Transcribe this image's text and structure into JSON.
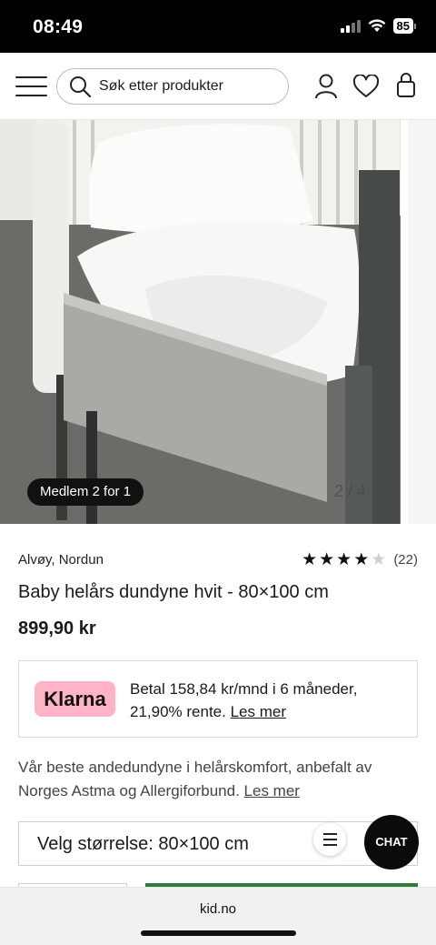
{
  "status_bar": {
    "time": "08:49",
    "battery": "85"
  },
  "header": {
    "menu_icon": "hamburger-menu-icon",
    "search": {
      "placeholder": "Søk etter produkter",
      "icon": "search-icon"
    },
    "icons": [
      "user-icon",
      "heart-icon",
      "shopping-bag-icon"
    ]
  },
  "gallery": {
    "badge": "Medlem 2 for 1",
    "pager": "2 / 4"
  },
  "product": {
    "brand": "Alvøy, Nordun",
    "rating": {
      "stars": 4,
      "max": 5,
      "count": "(22)"
    },
    "title": "Baby helårs dundyne hvit - 80×100 cm",
    "price": "899,90 kr"
  },
  "klarna": {
    "logo": "Klarna",
    "text": "Betal 158,84 kr/mnd i 6 måneder, 21,90% rente.",
    "link": "Les mer"
  },
  "description": {
    "text": "Vår beste andedundyne i helårskomfort, anbefalt av Norges Astma og Allergiforbund.",
    "link": "Les mer"
  },
  "size_selector": {
    "label": "Velg størrelse: 80×100 cm"
  },
  "chat": {
    "label": "CHAT"
  },
  "browser": {
    "url": "kid.no"
  },
  "colors": {
    "klarna_pink": "#ffb3c7",
    "cart_green": "#2f7d3b",
    "badge_bg": "#111111"
  }
}
